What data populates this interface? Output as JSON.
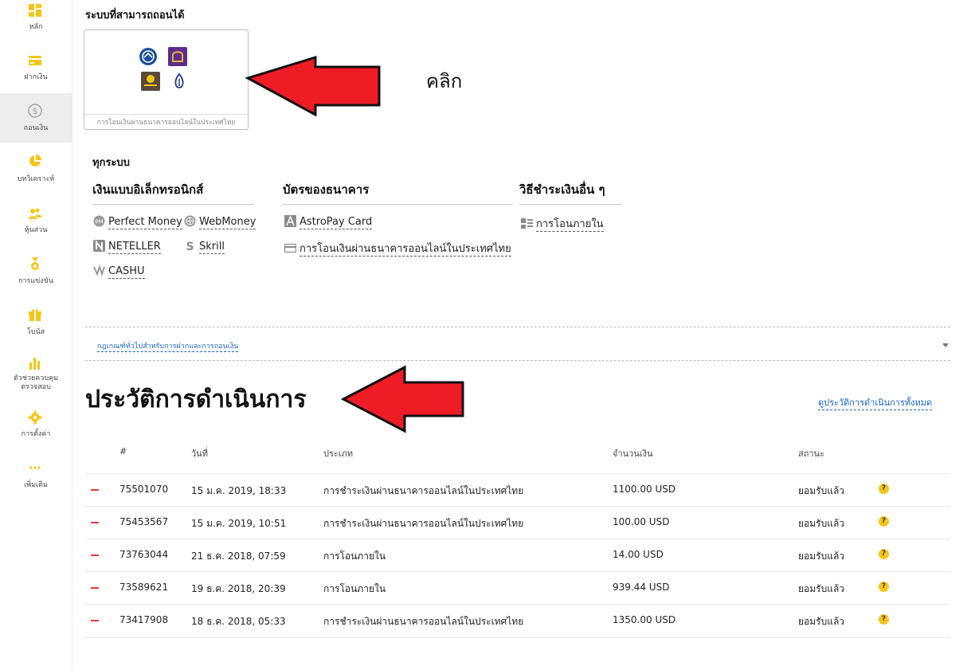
{
  "sidebar": {
    "items": [
      {
        "label": "หลัก",
        "icon": "dashboard-icon"
      },
      {
        "label": "ฝากเงิน",
        "icon": "card-icon"
      },
      {
        "label": "ถอนเงิน",
        "icon": "dollar-icon"
      },
      {
        "label": "บทวิเคราะห์",
        "icon": "pie-chart-icon"
      },
      {
        "label": "หุ้นส่วน",
        "icon": "partners-icon"
      },
      {
        "label": "การแข่งขัน",
        "icon": "medal-icon"
      },
      {
        "label": "โบนัส",
        "icon": "gift-icon"
      },
      {
        "label": "ตัวช่วยควบคุม",
        "label2": "ตรวจสอบ",
        "icon": "bar-chart-icon"
      },
      {
        "label": "การตั้งค่า",
        "icon": "gear-icon"
      },
      {
        "label": "เพิ่มเติม",
        "icon": "more-icon"
      }
    ]
  },
  "available": {
    "heading": "ระบบที่สามารถถอนได้",
    "card_caption": "การโอนเงินผ่านธนาคารออนไลน์ในประเทศไทย"
  },
  "annotation": {
    "click_label": "คลิก"
  },
  "all_systems": {
    "heading": "ทุกระบบ",
    "columns": [
      {
        "title": "เงินแบบอิเล็กทรอนิกส์",
        "items": [
          "Perfect Money",
          "WebMoney",
          "NETELLER",
          "Skrill",
          "CASHU"
        ]
      },
      {
        "title": "บัตรของธนาคาร",
        "items": [
          "AstroPay Card",
          "การโอนเงินผ่านธนาคารออนไลน์ในประเทศไทย"
        ]
      },
      {
        "title": "วิธีชำระเงินอื่น ๆ",
        "items": [
          "การโอนภายใน"
        ]
      }
    ]
  },
  "rules_link": "กฎเกณฑ์ทั่วไปสำหรับการฝากและการถอนเงิน",
  "history": {
    "title": "ประวัติการดำเนินการ",
    "view_all": "ดูประวัติการดำเนินการทั้งหมด",
    "headers": [
      "#",
      "วันที่",
      "ประเภท",
      "จำนวนเงิน",
      "สถานะ"
    ],
    "rows": [
      {
        "id": "75501070",
        "date": "15 ม.ค. 2019, 18:33",
        "type": "การชำระเงินผ่านธนาคารออนไลน์ในประเทศไทย",
        "amount": "1100.00 USD",
        "status": "ยอมรับแล้ว"
      },
      {
        "id": "75453567",
        "date": "15 ม.ค. 2019, 10:51",
        "type": "การชำระเงินผ่านธนาคารออนไลน์ในประเทศไทย",
        "amount": "100.00 USD",
        "status": "ยอมรับแล้ว"
      },
      {
        "id": "73763044",
        "date": "21 ธ.ค. 2018, 07:59",
        "type": "การโอนภายใน",
        "amount": "14.00 USD",
        "status": "ยอมรับแล้ว"
      },
      {
        "id": "73589621",
        "date": "19 ธ.ค. 2018, 20:39",
        "type": "การโอนภายใน",
        "amount": "939.44 USD",
        "status": "ยอมรับแล้ว"
      },
      {
        "id": "73417908",
        "date": "18 ธ.ค. 2018, 05:33",
        "type": "การชำระเงินผ่านธนาคารออนไลน์ในประเทศไทย",
        "amount": "1350.00 USD",
        "status": "ยอมรับแล้ว"
      }
    ]
  },
  "colors": {
    "accent": "#f5c518",
    "link": "#1a62c8",
    "arrow": "#ee1c25",
    "minus": "#e53935"
  }
}
